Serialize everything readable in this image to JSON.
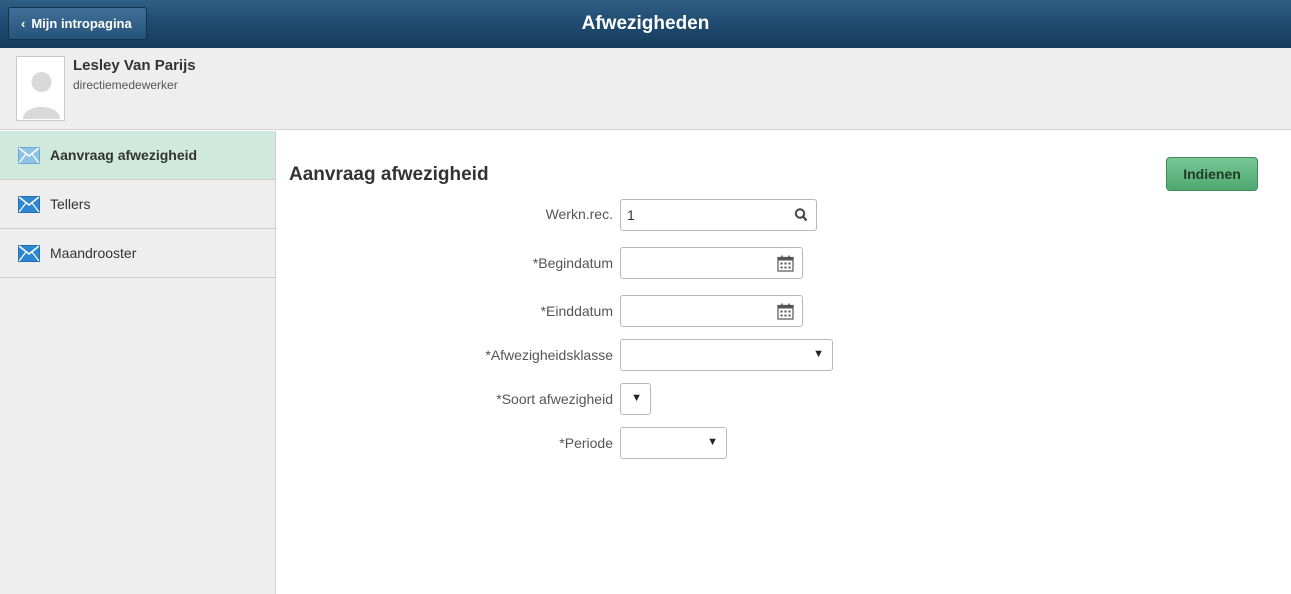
{
  "header": {
    "back_label": "Mijn intropagina",
    "title": "Afwezigheden"
  },
  "user": {
    "name": "Lesley Van Parijs",
    "role": "directiemedewerker"
  },
  "sidebar": {
    "items": [
      {
        "label": "Aanvraag afwezigheid",
        "icon": "envelope-icon",
        "active": true
      },
      {
        "label": "Tellers",
        "icon": "envelope-icon",
        "active": false
      },
      {
        "label": "Maandrooster",
        "icon": "envelope-icon",
        "active": false
      }
    ]
  },
  "form": {
    "title": "Aanvraag afwezigheid",
    "submit_label": "Indienen",
    "fields": {
      "werknrec": {
        "label": "Werkn.rec.",
        "value": "1",
        "icon": "search-icon"
      },
      "begindatum": {
        "label": "*Begindatum",
        "value": "",
        "icon": "calendar-icon"
      },
      "einddatum": {
        "label": "*Einddatum",
        "value": "",
        "icon": "calendar-icon"
      },
      "afwezigheidsklasse": {
        "label": "*Afwezigheidsklasse",
        "value": ""
      },
      "soort": {
        "label": "*Soort afwezigheid",
        "value": ""
      },
      "periode": {
        "label": "*Periode",
        "value": ""
      }
    }
  },
  "colors": {
    "header": "#1f4a6f",
    "active_nav": "#cfe9dc",
    "submit": "#5fb57f"
  }
}
